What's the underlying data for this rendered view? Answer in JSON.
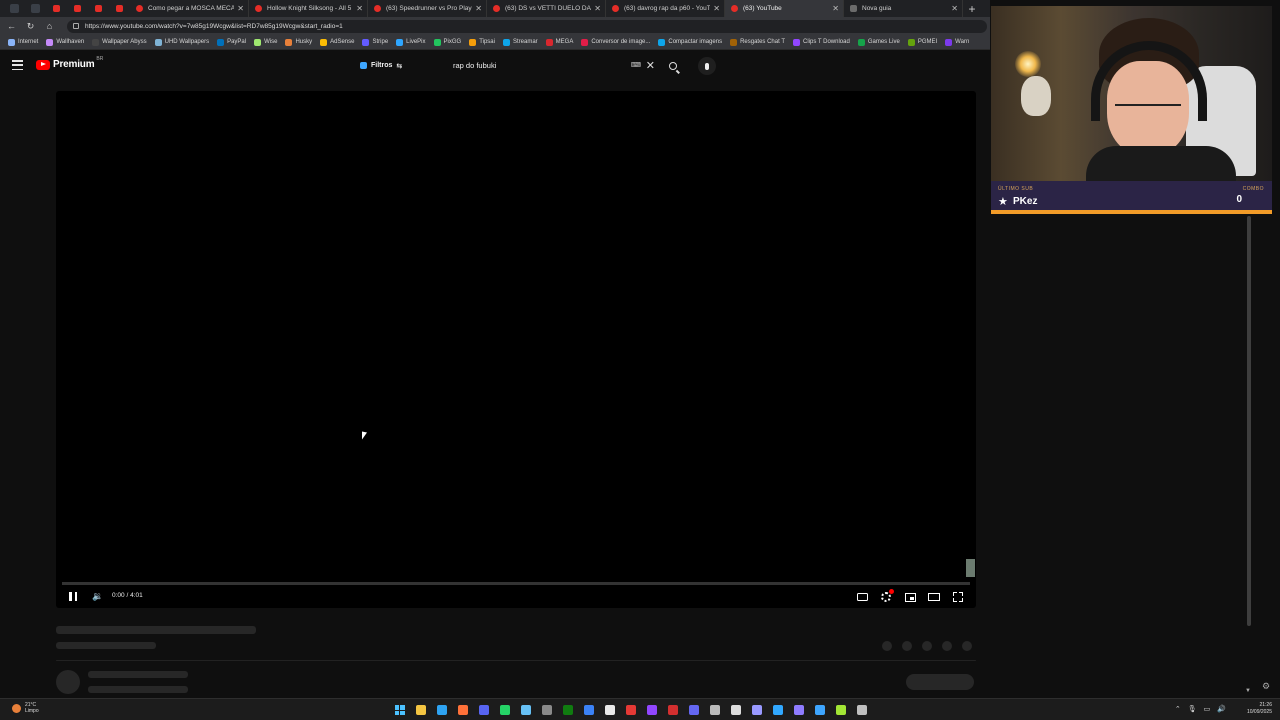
{
  "browser": {
    "tabs": [
      {
        "title": "Como pegar a MOSCA MECÂNIC",
        "type": "youtube"
      },
      {
        "title": "Hollow Knight Silksong - All 5 Ra",
        "type": "youtube"
      },
      {
        "title": "(63) Speedrunner vs Pro Player d",
        "type": "youtube"
      },
      {
        "title": "(63) DS vs VETTI DUELO DA NOS",
        "type": "youtube"
      },
      {
        "title": "(63) davrog rap da p60 - YouTube",
        "type": "youtube"
      },
      {
        "title": "(63) YouTube",
        "type": "youtube",
        "active": true
      },
      {
        "title": "Nova guia",
        "type": "newtab"
      }
    ],
    "url": "https://www.youtube.com/watch?v=7w85g19Wcgw&list=RD7w85g19Wcgw&start_radio=1",
    "bookmarks": [
      {
        "label": "Internet",
        "color": "#8ab4f8"
      },
      {
        "label": "Wallhaven",
        "color": "#c58af9"
      },
      {
        "label": "Wallpaper Abyss",
        "color": "#444444"
      },
      {
        "label": "UHD Wallpapers",
        "color": "#7fb3d5"
      },
      {
        "label": "PayPal",
        "color": "#0070ba"
      },
      {
        "label": "Wise",
        "color": "#9fe870"
      },
      {
        "label": "Husky",
        "color": "#e8803a"
      },
      {
        "label": "AdSense",
        "color": "#fbbc04"
      },
      {
        "label": "Stripe",
        "color": "#635bff"
      },
      {
        "label": "LivePix",
        "color": "#2ea6ff"
      },
      {
        "label": "PixGG",
        "color": "#22c55e"
      },
      {
        "label": "Tipsai",
        "color": "#f59e0b"
      },
      {
        "label": "Streamar",
        "color": "#0ea5e9"
      },
      {
        "label": "MEGA",
        "color": "#d9272e"
      },
      {
        "label": "Conversor de image...",
        "color": "#e11d48"
      },
      {
        "label": "Compactar imagens",
        "color": "#0ea5e9"
      },
      {
        "label": "Resgates Chat T",
        "color": "#a16207"
      },
      {
        "label": "Clips T Download",
        "color": "#9146ff"
      },
      {
        "label": "Games Live",
        "color": "#16a34a"
      },
      {
        "label": "PGMEI",
        "color": "#65a30d"
      },
      {
        "label": "Warn",
        "color": "#7c3aed"
      }
    ]
  },
  "youtube": {
    "logo_text": "Premium",
    "country": "BR",
    "filters_label": "Filtros",
    "search_value": "rap do fubuki",
    "keyboard_icon": "⌨",
    "clear_icon": "✕"
  },
  "player": {
    "time": "0:00 / 4:01",
    "progress": 0.0
  },
  "overlay": {
    "last_sub_label": "ÚLTIMO SUB",
    "last_sub_name": "PKez",
    "combo_label": "COMBO",
    "combo_value": "0"
  },
  "taskbar": {
    "weather_temp": "21°C",
    "weather_desc": "Limpo",
    "time": "21:26",
    "date": "10/09/2025",
    "apps": [
      {
        "name": "windows-start",
        "color": "#4cc2ff"
      },
      {
        "name": "file-explorer",
        "color": "#f4c542"
      },
      {
        "name": "edge",
        "color": "#2ea3f2"
      },
      {
        "name": "firefox",
        "color": "#ff7139"
      },
      {
        "name": "discord-like",
        "color": "#5865f2"
      },
      {
        "name": "whatsapp",
        "color": "#25d366"
      },
      {
        "name": "steam",
        "color": "#66c0f4"
      },
      {
        "name": "app-8",
        "color": "#8a8a8a"
      },
      {
        "name": "xbox",
        "color": "#107c10"
      },
      {
        "name": "app-10",
        "color": "#3b82f6"
      },
      {
        "name": "chrome",
        "color": "#e8e8e8"
      },
      {
        "name": "record",
        "color": "#e53935"
      },
      {
        "name": "twitch",
        "color": "#9146ff"
      },
      {
        "name": "acrobat",
        "color": "#d32f2f"
      },
      {
        "name": "app-15",
        "color": "#6366f1"
      },
      {
        "name": "app-16",
        "color": "#bbbbbb"
      },
      {
        "name": "obs",
        "color": "#dddddd"
      },
      {
        "name": "premiere",
        "color": "#9999ff"
      },
      {
        "name": "photoshop",
        "color": "#31a8ff"
      },
      {
        "name": "media-encoder",
        "color": "#8f7cff"
      },
      {
        "name": "app-21",
        "color": "#3ea6ff"
      },
      {
        "name": "app-22",
        "color": "#a3e635"
      },
      {
        "name": "settings",
        "color": "#bfbfbf"
      }
    ]
  }
}
